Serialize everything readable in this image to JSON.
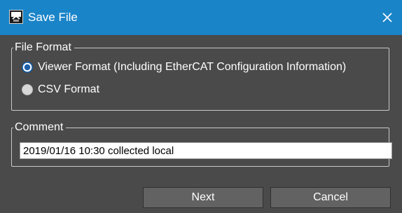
{
  "window": {
    "title": "Save File",
    "icon": "save-file-icon",
    "close_icon": "close-icon"
  },
  "file_format": {
    "legend": "File Format",
    "options": [
      {
        "label": "Viewer Format (Including EtherCAT Configuration Information)",
        "selected": true
      },
      {
        "label": "CSV Format",
        "selected": false
      }
    ]
  },
  "comment": {
    "legend": "Comment",
    "value": "2019/01/16 10:30 collected local"
  },
  "buttons": {
    "next_label": "Next",
    "cancel_label": "Cancel"
  },
  "colors": {
    "titlebar": "#1a84c8",
    "background": "#4a4a4a",
    "button": "#626262",
    "radio_selected": "#1f73c0"
  }
}
